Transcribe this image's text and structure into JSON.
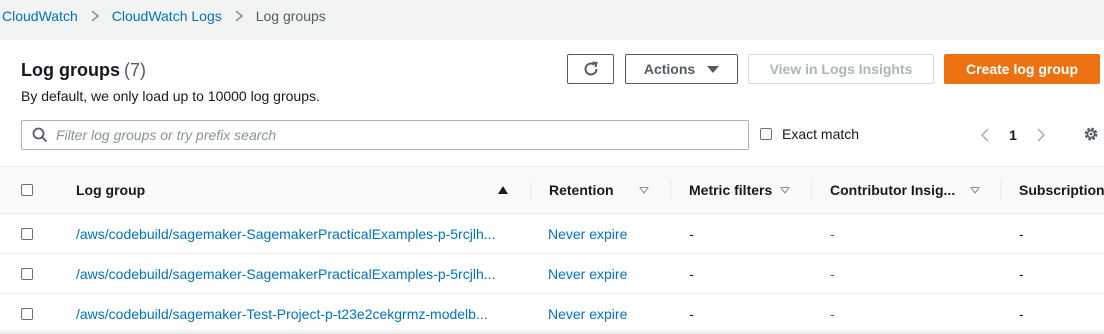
{
  "breadcrumb": {
    "items": [
      "CloudWatch",
      "CloudWatch Logs"
    ],
    "current": "Log groups"
  },
  "header": {
    "title": "Log groups",
    "count": "(7)",
    "description": "By default, we only load up to 10000 log groups.",
    "actions_label": "Actions",
    "insights_label": "View in Logs Insights",
    "create_label": "Create log group"
  },
  "filter": {
    "placeholder": "Filter log groups or try prefix search",
    "value": "",
    "exact_match_label": "Exact match"
  },
  "pagination": {
    "page": "1"
  },
  "table": {
    "columns": [
      "Log group",
      "Retention",
      "Metric filters",
      "Contributor Insig...",
      "Subscription"
    ],
    "rows": [
      {
        "log_group": "/aws/codebuild/sagemaker-SagemakerPracticalExamples-p-5rcjlh...",
        "retention": "Never expire",
        "metric_filters": "-",
        "contributor": "-",
        "subscription": "-"
      },
      {
        "log_group": "/aws/codebuild/sagemaker-SagemakerPracticalExamples-p-5rcjlh...",
        "retention": "Never expire",
        "metric_filters": "-",
        "contributor": "-",
        "subscription": "-"
      },
      {
        "log_group": "/aws/codebuild/sagemaker-Test-Project-p-t23e2cekgrmz-modelb...",
        "retention": "Never expire",
        "metric_filters": "-",
        "contributor": "-",
        "subscription": "-"
      }
    ]
  },
  "colors": {
    "link": "#0073bb",
    "primary_button": "#ec7211",
    "disabled_text": "#aab7b8",
    "background": "#f2f3f3"
  },
  "icons": {
    "breadcrumb_separator": "chevron-right-icon",
    "refresh": "refresh-icon",
    "actions_caret": "caret-down-icon",
    "search": "search-icon",
    "prev_page": "chevron-left-icon",
    "next_page": "chevron-right-icon",
    "settings": "gear-icon",
    "sort": "sort-ascending-icon"
  }
}
